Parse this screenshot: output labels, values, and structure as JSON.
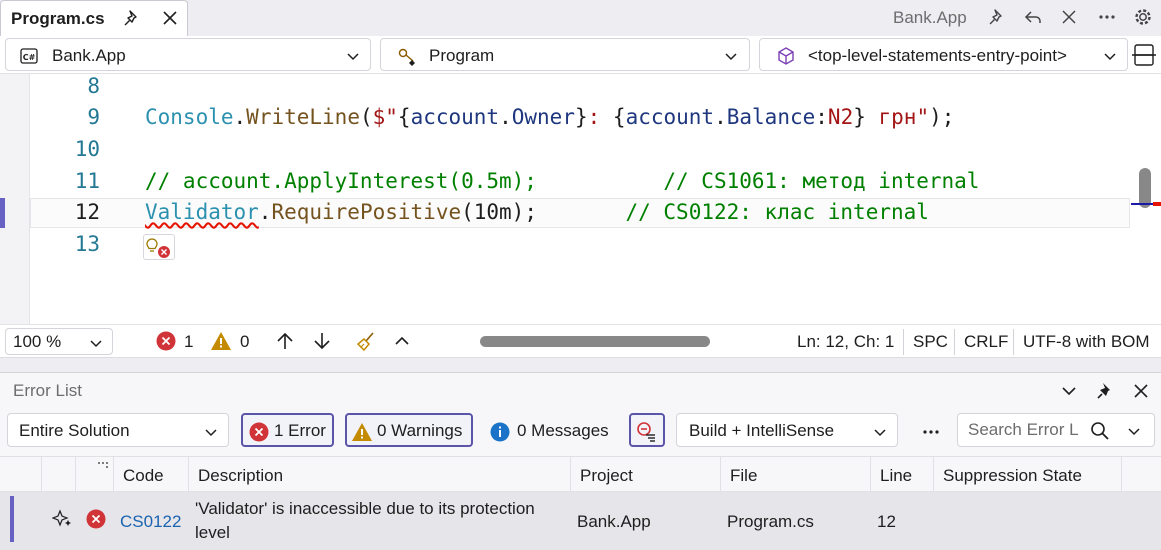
{
  "tab": {
    "title": "Program.cs",
    "project": "Bank.App"
  },
  "navbar": {
    "project": "Bank.App",
    "type": "Program",
    "member": "<top-level-statements-entry-point>"
  },
  "editor": {
    "line_numbers": [
      "8",
      "9",
      "10",
      "11",
      "12",
      "13"
    ],
    "line9": {
      "t1": "Console",
      "p1": ".",
      "t2": "WriteLine",
      "p2": "(",
      "s1": "$\"",
      "b1": "{",
      "id1": "account",
      "p3": ".",
      "id2": "Owner",
      "b2": "}",
      "s2": ": ",
      "b3": "{",
      "id3": "account",
      "p4": ".",
      "id4": "Balance",
      "p5": ":",
      "f1": "N2",
      "b4": "}",
      "s3": " грн\"",
      "p6": ");"
    },
    "line11": "// account.ApplyInterest(0.5m);          // CS1061: метод internal",
    "line12": {
      "err": "Validator",
      "p1": ".",
      "m": "RequirePositive",
      "p2": "(10m);",
      "gap": "       ",
      "cmt": "// CS0122: клас internal"
    }
  },
  "status": {
    "zoom": "100 %",
    "errors": "1",
    "warnings": "0",
    "position": "Ln: 12, Ch: 1",
    "whitespace": "SPC",
    "line_ending": "CRLF",
    "encoding": "UTF-8 with BOM"
  },
  "error_list": {
    "title": "Error List",
    "scope": "Entire Solution",
    "errors_btn": "1 Error",
    "warnings_btn": "0 Warnings",
    "messages_btn": "0 Messages",
    "source": "Build + IntelliSense",
    "search_placeholder": "Search Error L",
    "columns": [
      "Code",
      "Description",
      "Project",
      "File",
      "Line",
      "Suppression State"
    ],
    "rows": [
      {
        "code": "CS0122",
        "description": "'Validator' is inaccessible due to its protection level",
        "project": "Bank.App",
        "file": "Program.cs",
        "line": "12",
        "suppression": ""
      }
    ]
  },
  "colors": {
    "accent": "#5a55a8",
    "error": "#d13438",
    "warning": "#c48a00",
    "info": "#1a73c8",
    "comment": "#008000",
    "type": "#2b91af"
  }
}
